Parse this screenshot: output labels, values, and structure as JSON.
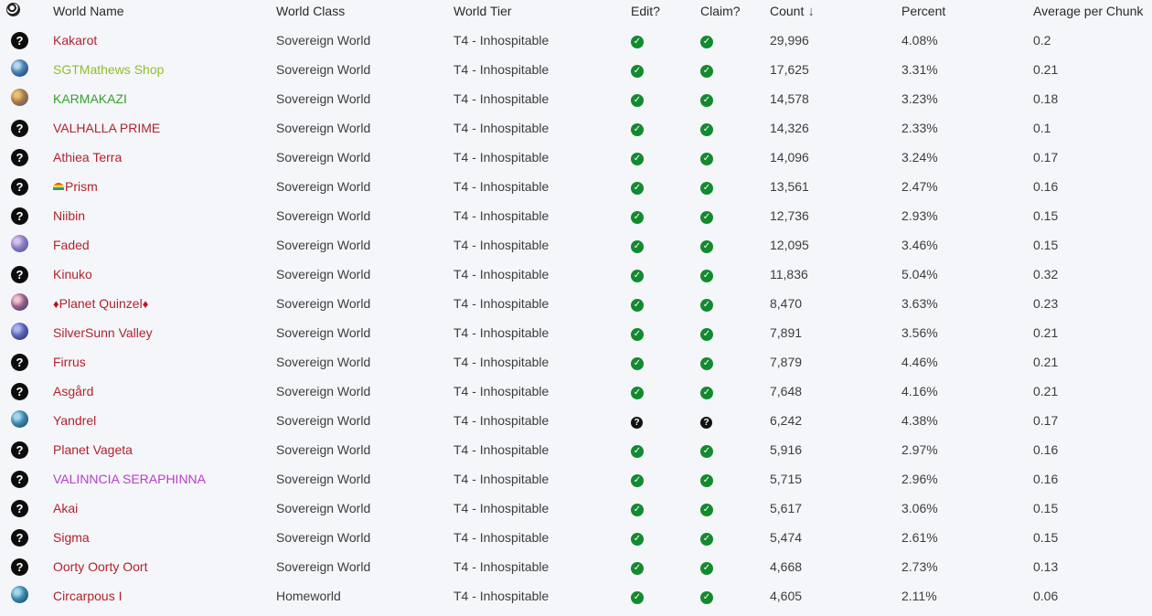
{
  "headers": {
    "icon": "globe-icon",
    "world_name": "World Name",
    "world_class": "World Class",
    "world_tier": "World Tier",
    "edit": "Edit?",
    "claim": "Claim?",
    "count": "Count",
    "count_sort": "↓",
    "percent": "Percent",
    "avg": "Average per Chunk"
  },
  "rows": [
    {
      "icon": "question-icon",
      "name": "Kakarot",
      "name_color": "#b0232c",
      "class": "Sovereign World",
      "tier": "T4 - Inhospitable",
      "edit": "check",
      "claim": "check",
      "count": "29,996",
      "percent": "4.08%",
      "avg": "0.2"
    },
    {
      "icon": "planet-icon",
      "name": "SGTMathews Shop",
      "name_color": "#8fbe2c",
      "class": "Sovereign World",
      "tier": "T4 - Inhospitable",
      "edit": "check",
      "claim": "check",
      "count": "17,625",
      "percent": "3.31%",
      "avg": "0.21"
    },
    {
      "icon": "planet-icon",
      "name": "KARMAKAZI",
      "name_color": "#35a12a",
      "class": "Sovereign World",
      "tier": "T4 - Inhospitable",
      "edit": "check",
      "claim": "check",
      "count": "14,578",
      "percent": "3.23%",
      "avg": "0.18"
    },
    {
      "icon": "question-icon",
      "name": "VALHALLA PRIME",
      "name_color": "#b0232c",
      "class": "Sovereign World",
      "tier": "T4 - Inhospitable",
      "edit": "check",
      "claim": "check",
      "count": "14,326",
      "percent": "2.33%",
      "avg": "0.1"
    },
    {
      "icon": "question-icon",
      "name": "Athiea Terra",
      "name_color": "#b0232c",
      "class": "Sovereign World",
      "tier": "T4 - Inhospitable",
      "edit": "check",
      "claim": "check",
      "count": "14,096",
      "percent": "3.24%",
      "avg": "0.17"
    },
    {
      "icon": "question-icon",
      "name": "Prism",
      "name_color": "#b0232c",
      "class": "Sovereign World",
      "tier": "T4 - Inhospitable",
      "edit": "check",
      "claim": "check",
      "count": "13,561",
      "percent": "2.47%",
      "avg": "0.16"
    },
    {
      "icon": "question-icon",
      "name": "Niibin",
      "name_color": "#b0232c",
      "class": "Sovereign World",
      "tier": "T4 - Inhospitable",
      "edit": "check",
      "claim": "check",
      "count": "12,736",
      "percent": "2.93%",
      "avg": "0.15"
    },
    {
      "icon": "planet-icon",
      "name": "Faded",
      "name_color": "#b0232c",
      "class": "Sovereign World",
      "tier": "T4 - Inhospitable",
      "edit": "check",
      "claim": "check",
      "count": "12,095",
      "percent": "3.46%",
      "avg": "0.15"
    },
    {
      "icon": "question-icon",
      "name": "Kinuko",
      "name_color": "#b0232c",
      "class": "Sovereign World",
      "tier": "T4 - Inhospitable",
      "edit": "check",
      "claim": "check",
      "count": "11,836",
      "percent": "5.04%",
      "avg": "0.32"
    },
    {
      "icon": "planet-icon",
      "name": "Planet Quinzel",
      "name_color": "#b0232c",
      "class": "Sovereign World",
      "tier": "T4 - Inhospitable",
      "edit": "check",
      "claim": "check",
      "count": "8,470",
      "percent": "3.63%",
      "avg": "0.23"
    },
    {
      "icon": "planet-icon",
      "name": "SilverSunn Valley",
      "name_color": "#b0232c",
      "class": "Sovereign World",
      "tier": "T4 - Inhospitable",
      "edit": "check",
      "claim": "check",
      "count": "7,891",
      "percent": "3.56%",
      "avg": "0.21"
    },
    {
      "icon": "question-icon",
      "name": "Firrus",
      "name_color": "#b0232c",
      "class": "Sovereign World",
      "tier": "T4 - Inhospitable",
      "edit": "check",
      "claim": "check",
      "count": "7,879",
      "percent": "4.46%",
      "avg": "0.21"
    },
    {
      "icon": "question-icon",
      "name": "Asgård",
      "name_color": "#b0232c",
      "class": "Sovereign World",
      "tier": "T4 - Inhospitable",
      "edit": "check",
      "claim": "check",
      "count": "7,648",
      "percent": "4.16%",
      "avg": "0.21"
    },
    {
      "icon": "planet-icon",
      "name": "Yandrel",
      "name_color": "#b0232c",
      "class": "Sovereign World",
      "tier": "T4 - Inhospitable",
      "edit": "unknown",
      "claim": "unknown",
      "count": "6,242",
      "percent": "4.38%",
      "avg": "0.17"
    },
    {
      "icon": "question-icon",
      "name": "Planet Vageta",
      "name_color": "#b0232c",
      "class": "Sovereign World",
      "tier": "T4 - Inhospitable",
      "edit": "check",
      "claim": "check",
      "count": "5,916",
      "percent": "2.97%",
      "avg": "0.16"
    },
    {
      "icon": "question-icon",
      "name": "VALINNCIA SERAPHINNA",
      "name_color": "#b63ec9",
      "class": "Sovereign World",
      "tier": "T4 - Inhospitable",
      "edit": "check",
      "claim": "check",
      "count": "5,715",
      "percent": "2.96%",
      "avg": "0.16"
    },
    {
      "icon": "question-icon",
      "name": "Akai",
      "name_color": "#b0232c",
      "class": "Sovereign World",
      "tier": "T4 - Inhospitable",
      "edit": "check",
      "claim": "check",
      "count": "5,617",
      "percent": "3.06%",
      "avg": "0.15"
    },
    {
      "icon": "question-icon",
      "name": "Sigma",
      "name_color": "#b0232c",
      "class": "Sovereign World",
      "tier": "T4 - Inhospitable",
      "edit": "check",
      "claim": "check",
      "count": "5,474",
      "percent": "2.61%",
      "avg": "0.15"
    },
    {
      "icon": "question-icon",
      "name": "Oorty Oorty Oort",
      "name_color": "#b0232c",
      "class": "Sovereign World",
      "tier": "T4 - Inhospitable",
      "edit": "check",
      "claim": "check",
      "count": "4,668",
      "percent": "2.73%",
      "avg": "0.13"
    },
    {
      "icon": "planet-icon",
      "name": "Circarpous I",
      "name_color": "#b0232c",
      "class": "Homeworld",
      "tier": "T4 - Inhospitable",
      "edit": "check",
      "claim": "check",
      "count": "4,605",
      "percent": "2.11%",
      "avg": "0.06"
    }
  ]
}
